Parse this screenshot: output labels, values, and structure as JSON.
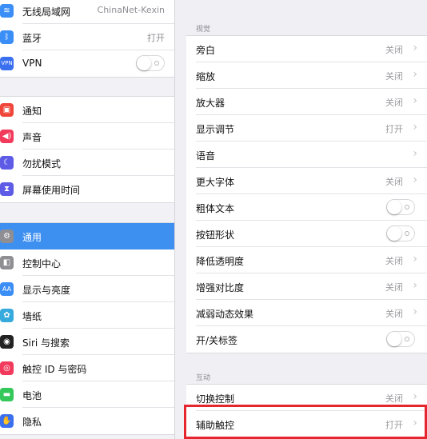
{
  "sidebar": {
    "group1": [
      {
        "label": "无线局域网",
        "value": "ChinaNet-Kexin",
        "icon": "wifi-icon",
        "color": "#3a8ef6"
      },
      {
        "label": "蓝牙",
        "value": "打开",
        "icon": "bluetooth-icon",
        "color": "#3a8ef6"
      },
      {
        "label": "VPN",
        "icon": "vpn-icon",
        "color": "#3a6ff0",
        "toggle": false
      }
    ],
    "group2": [
      {
        "label": "通知",
        "icon": "notifications-icon",
        "color": "#f0463a"
      },
      {
        "label": "声音",
        "icon": "sound-icon",
        "color": "#f23a5c"
      },
      {
        "label": "勿扰模式",
        "icon": "moon-icon",
        "color": "#5e5ce6"
      },
      {
        "label": "屏幕使用时间",
        "icon": "hourglass-icon",
        "color": "#5e5ce6"
      }
    ],
    "group3": [
      {
        "label": "通用",
        "icon": "gear-icon",
        "color": "#8e8e93",
        "selected": true
      },
      {
        "label": "控制中心",
        "icon": "control-center-icon",
        "color": "#8e8e93"
      },
      {
        "label": "显示与亮度",
        "icon": "display-icon",
        "color": "#3a8ef6"
      },
      {
        "label": "墙纸",
        "icon": "wallpaper-icon",
        "color": "#36aadc"
      },
      {
        "label": "Siri 与搜索",
        "icon": "siri-icon",
        "color": "#222222"
      },
      {
        "label": "触控 ID 与密码",
        "icon": "fingerprint-icon",
        "color": "#f23a5c"
      },
      {
        "label": "电池",
        "icon": "battery-icon",
        "color": "#34c759"
      },
      {
        "label": "隐私",
        "icon": "privacy-hand-icon",
        "color": "#3a6ff0"
      }
    ]
  },
  "main": {
    "vision_header": "视觉",
    "vision_rows": [
      {
        "label": "旁白",
        "value": "关闭",
        "chevron": true
      },
      {
        "label": "缩放",
        "value": "关闭",
        "chevron": true
      },
      {
        "label": "放大器",
        "value": "关闭",
        "chevron": true
      },
      {
        "label": "显示调节",
        "value": "打开",
        "chevron": true
      },
      {
        "label": "语音",
        "chevron": true
      },
      {
        "label": "更大字体",
        "value": "关闭",
        "chevron": true
      },
      {
        "label": "粗体文本",
        "toggle": false
      },
      {
        "label": "按钮形状",
        "toggle": false
      },
      {
        "label": "降低透明度",
        "value": "关闭",
        "chevron": true
      },
      {
        "label": "增强对比度",
        "value": "关闭",
        "chevron": true
      },
      {
        "label": "减弱动态效果",
        "value": "关闭",
        "chevron": true
      },
      {
        "label": "开/关标签",
        "toggle": false
      }
    ],
    "interaction_header": "互动",
    "interaction_rows": [
      {
        "label": "切换控制",
        "value": "关闭",
        "chevron": true
      },
      {
        "label": "辅助触控",
        "value": "打开",
        "chevron": true,
        "highlighted": true
      }
    ]
  },
  "colors": {
    "accent": "#3d8ff0",
    "highlight_box": "#e5262e"
  }
}
